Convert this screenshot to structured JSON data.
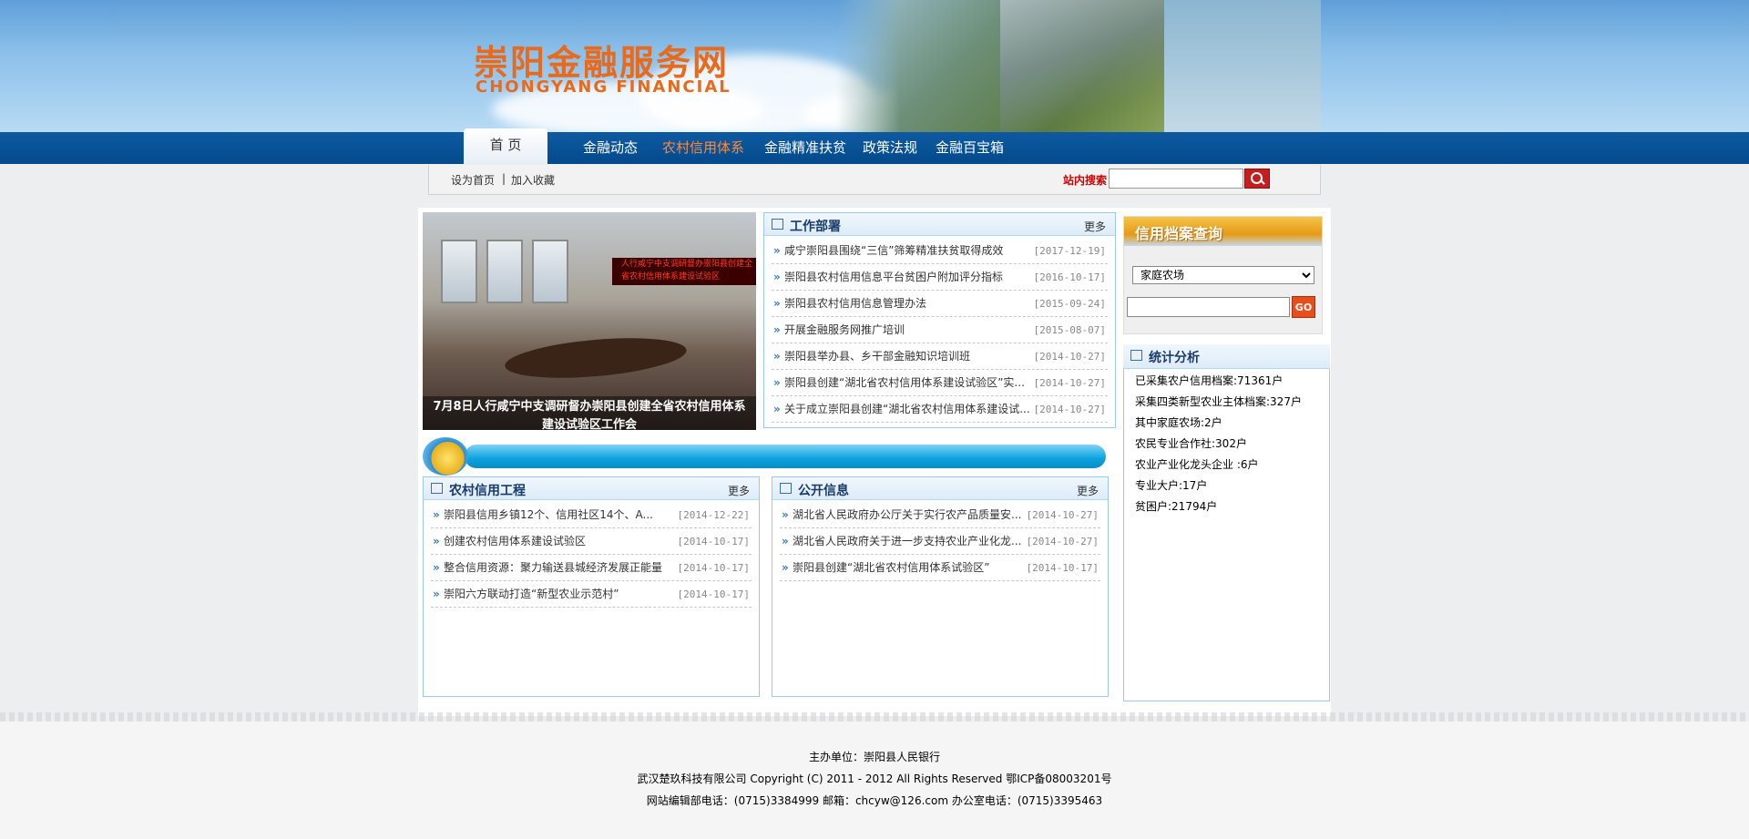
{
  "header": {
    "logo_cn": "崇阳金融服务网",
    "logo_en": "CHONGYANG FINANCIAL"
  },
  "nav": {
    "home": "首 页",
    "items": [
      "金融动态",
      "农村信用体系",
      "金融精准扶贫",
      "政策法规",
      "金融百宝箱"
    ],
    "active_index": 1,
    "active_color": "#ff8a3c",
    "bar_color": "#0d5aa1"
  },
  "toolbar": {
    "set_home": "设为首页",
    "divider": "|",
    "bookmark": "加入收藏",
    "search_label": "站内搜索"
  },
  "slide": {
    "banner_text": "人行咸宁中支调研督办崇阳县创建全省农村信用体系建设试验区",
    "caption": "7月8日人行咸宁中支调研督办崇阳县创建全省农村信用体系建设试验区工作会"
  },
  "work": {
    "title": "工作部署",
    "more": "更多",
    "items": [
      {
        "text": "咸宁崇阳县围绕“三信”筛筹精准扶贫取得成效",
        "date": "[2017-12-19]"
      },
      {
        "text": "崇阳县农村信用信息平台贫困户附加评分指标",
        "date": "[2016-10-17]"
      },
      {
        "text": "崇阳县农村信用信息管理办法",
        "date": "[2015-09-24]"
      },
      {
        "text": "开展金融服务网推广培训",
        "date": "[2015-08-07]"
      },
      {
        "text": "崇阳县举办县、乡干部金融知识培训班",
        "date": "[2014-10-27]"
      },
      {
        "text": "崇阳县创建“湖北省农村信用体系建设试验区”实...",
        "date": "[2014-10-27]"
      },
      {
        "text": "关于成立崇阳县创建“湖北省农村信用体系建设试...",
        "date": "[2014-10-27]"
      }
    ]
  },
  "rural": {
    "title": "农村信用工程",
    "more": "更多",
    "items": [
      {
        "text": "崇阳县信用乡镇12个、信用社区14个、A...",
        "date": "[2014-12-22]"
      },
      {
        "text": "创建农村信用体系建设试验区",
        "date": "[2014-10-17]"
      },
      {
        "text": "整合信用资源：聚力输送县城经济发展正能量",
        "date": "[2014-10-17]"
      },
      {
        "text": "崇阳六方联动打造“新型农业示范村”",
        "date": "[2014-10-17]"
      }
    ]
  },
  "public": {
    "title": "公开信息",
    "more": "更多",
    "items": [
      {
        "text": "湖北省人民政府办公厅关于实行农产品质量安...",
        "date": "[2014-10-27]"
      },
      {
        "text": "湖北省人民政府关于进一步支持农业产业化龙...",
        "date": "[2014-10-27]"
      },
      {
        "text": "崇阳县创建“湖北省农村信用体系试验区”",
        "date": "[2014-10-17]"
      }
    ]
  },
  "credit": {
    "title": "信用档案查询",
    "select_value": "家庭农场",
    "go": "GO"
  },
  "stats": {
    "title": "统计分析",
    "rows": [
      "已采集农户信用档案:71361户",
      "采集四类新型农业主体档案:327户",
      "其中家庭农场:2户",
      "农民专业合作社:302户",
      "农业产业化龙头企业 :6户",
      "专业大户:17户",
      "贫困户:21794户"
    ]
  },
  "footer": {
    "sponsor": "主办单位：崇阳县人民银行",
    "copyright": "武汉楚玖科技有限公司 Copyright (C) 2011 - 2012 All Rights Reserved 鄂ICP备08003201号",
    "contact": "网站编辑部电话：(0715)3384999 邮箱：chcyw@126.com 办公室电话：(0715)3395463"
  }
}
